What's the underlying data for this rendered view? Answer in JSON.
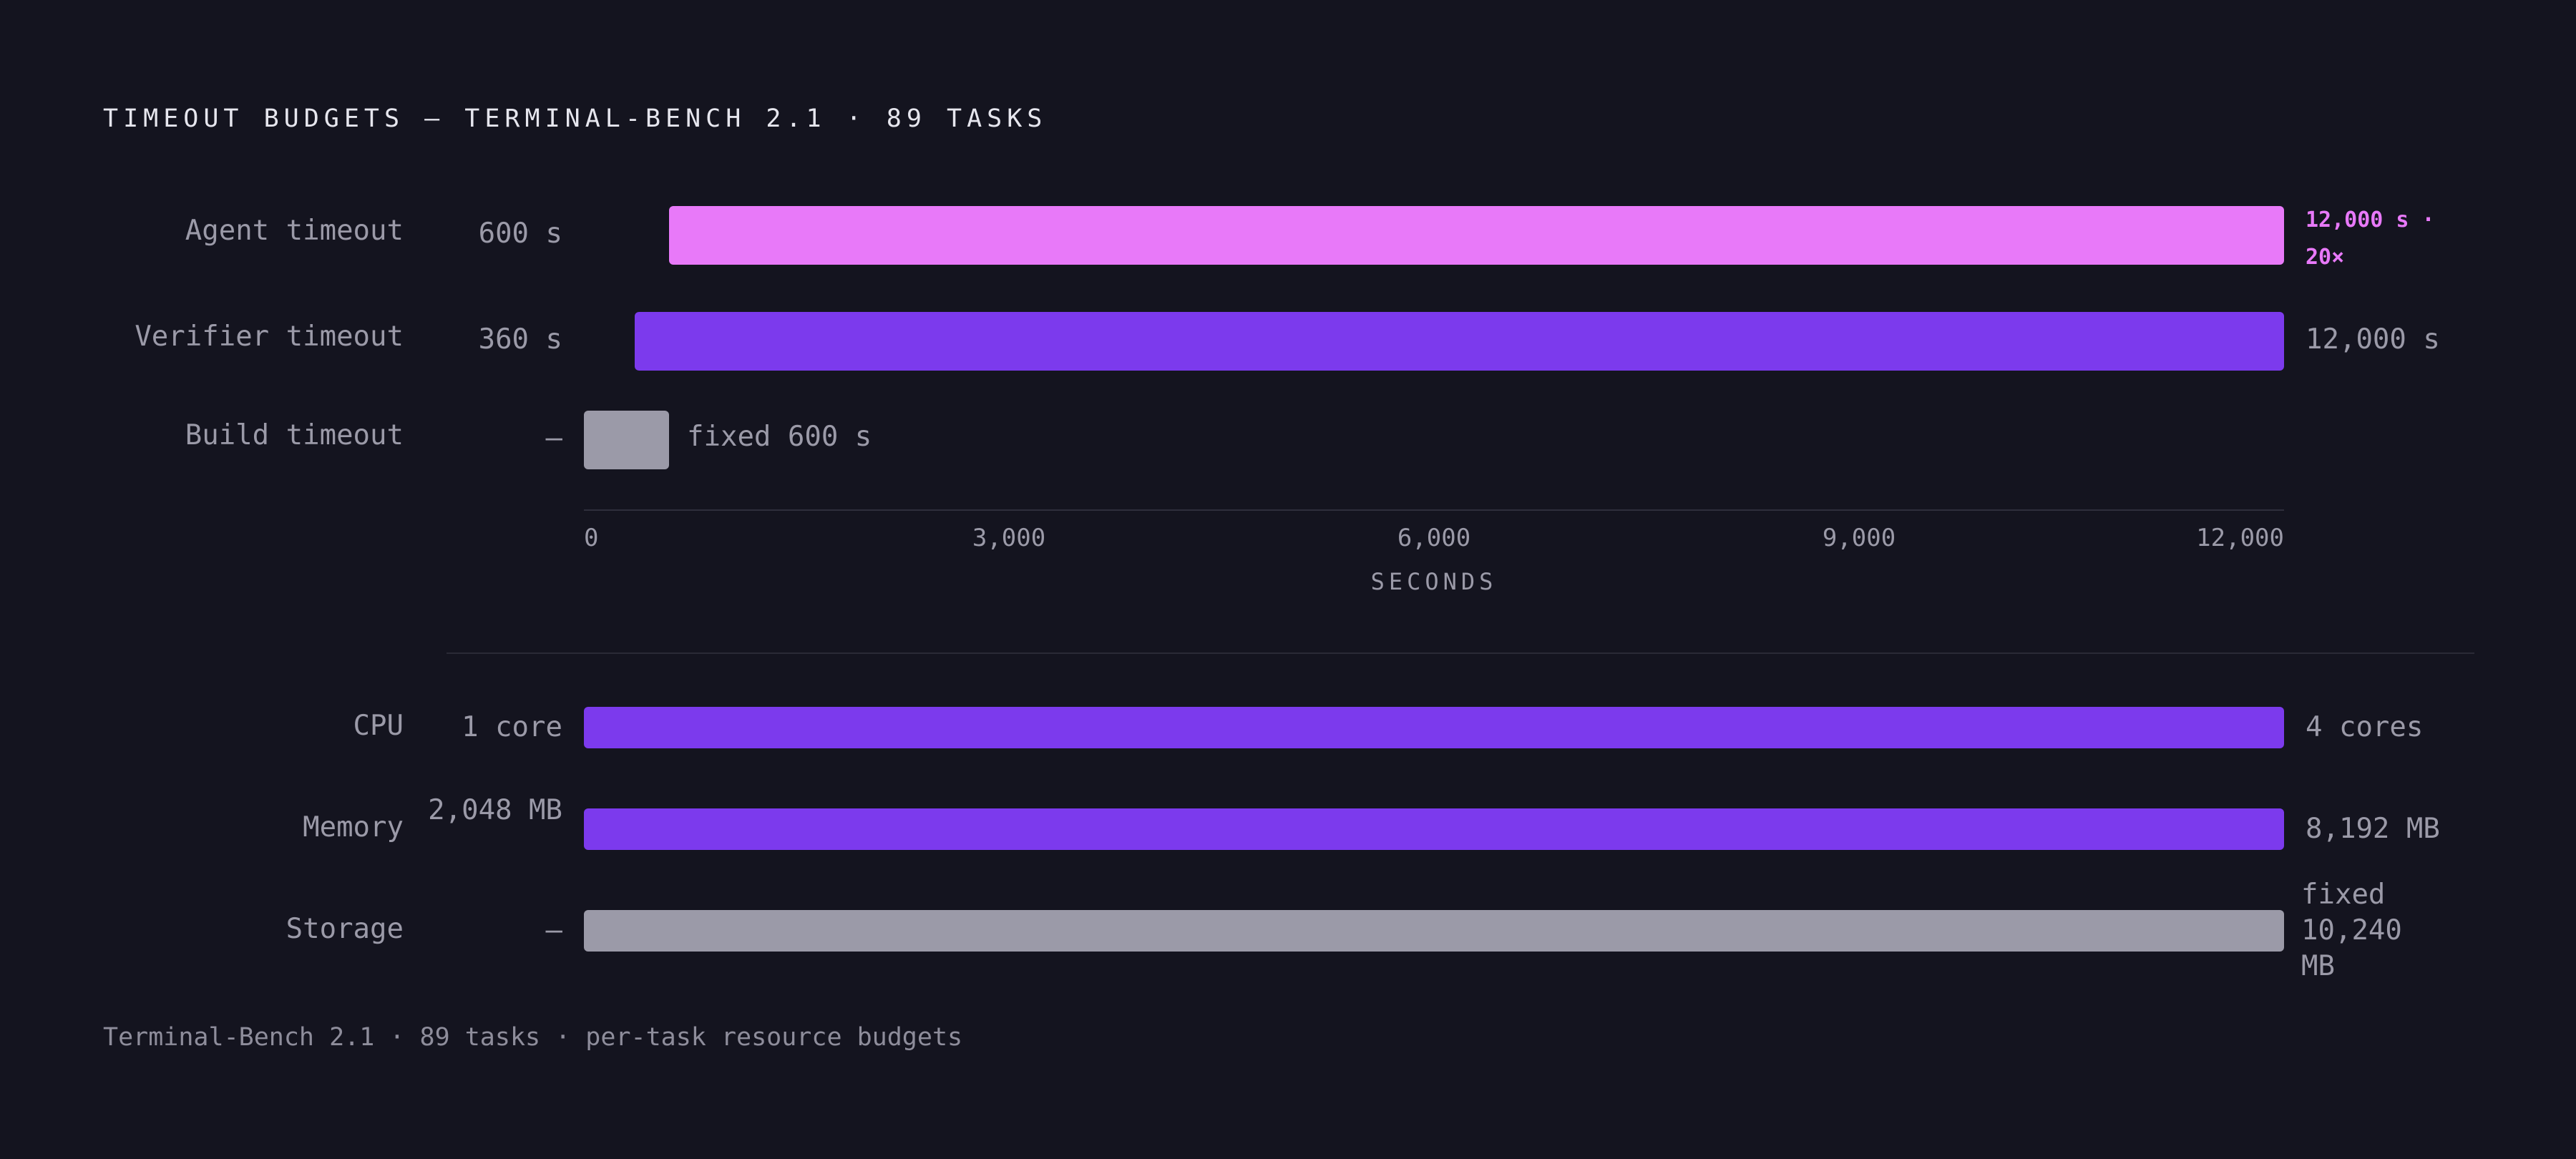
{
  "title": "TIMEOUT BUDGETS — TERMINAL-BENCH 2.1 · 89 TASKS",
  "colors": {
    "background": "#14141f",
    "agent": "#e879f9",
    "primary": "#7c3aed",
    "fixed": "#9b9aa8"
  },
  "chart_data": [
    {
      "type": "bar",
      "orientation": "horizontal",
      "xlabel": "SECONDS",
      "xlim": [
        0,
        12000
      ],
      "ticks": [
        "0",
        "3,000",
        "6,000",
        "9,000",
        "12,000"
      ],
      "tick_values": [
        0,
        3000,
        6000,
        9000,
        12000
      ],
      "rows": [
        {
          "label": "Agent timeout",
          "from": 600,
          "to": 12000,
          "from_label": "600 s",
          "to_label": "12,000 s · 20×",
          "color": "#e879f9",
          "highlight": true
        },
        {
          "label": "Verifier timeout",
          "from": 360,
          "to": 12000,
          "from_label": "360 s",
          "to_label": "12,000 s",
          "color": "#7c3aed"
        },
        {
          "label": "Build timeout",
          "from": 0,
          "to": 600,
          "from_label": "—",
          "to_label": "fixed 600 s",
          "color": "#9b9aa8",
          "fixed": true
        }
      ]
    },
    {
      "type": "bar",
      "orientation": "horizontal",
      "rows": [
        {
          "label": "CPU",
          "from_label": "1 core",
          "to_label": "4 cores",
          "from": 1,
          "to": 4,
          "color": "#7c3aed"
        },
        {
          "label": "Memory",
          "from_label": "2,048 MB",
          "to_label": "8,192 MB",
          "from": 2048,
          "to": 8192,
          "color": "#7c3aed"
        },
        {
          "label": "Storage",
          "from_label": "—",
          "to_label": "fixed 10,240 MB",
          "from": 10240,
          "to": 10240,
          "color": "#9b9aa8",
          "fixed": true
        }
      ]
    }
  ],
  "footer": "Terminal-Bench 2.1 · 89 tasks · per-task resource budgets"
}
